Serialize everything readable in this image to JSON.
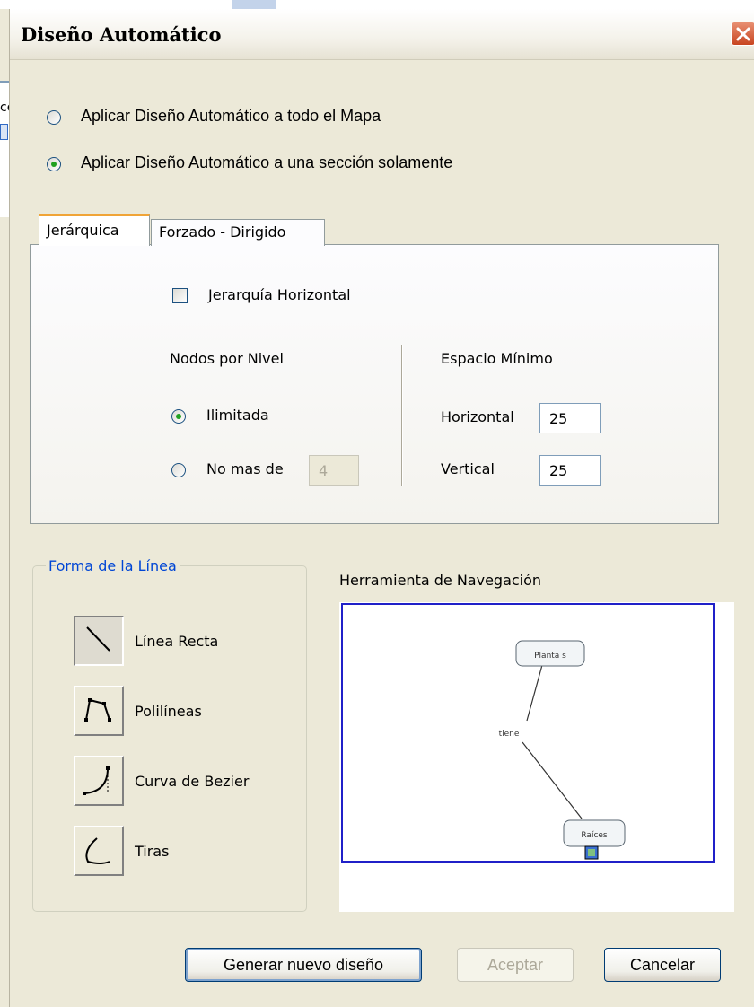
{
  "window": {
    "title": "Diseño Automático"
  },
  "background": {
    "partial_text": "ce"
  },
  "scope": {
    "options": [
      {
        "label": "Aplicar Diseño Automático a todo el Mapa",
        "selected": false
      },
      {
        "label": "Aplicar Diseño Automático a una sección solamente",
        "selected": true
      }
    ]
  },
  "tabs": [
    {
      "label": "Jerárquica",
      "active": true
    },
    {
      "label": "Forzado  - Dirigido",
      "active": false
    }
  ],
  "hierarchy": {
    "horizontal_label": "Jerarquía Horizontal",
    "horizontal_checked": false,
    "nodes_per_level": {
      "title": "Nodos por Nivel",
      "unlimited_label": "Ilimitada",
      "max_label": "No mas de",
      "max_value": "4",
      "selected": "unlimited"
    },
    "min_space": {
      "title": "Espacio Mínimo",
      "horizontal_label": "Horizontal",
      "horizontal_value": "25",
      "vertical_label": "Vertical",
      "vertical_value": "25"
    }
  },
  "line_shape": {
    "title": "Forma de la Línea",
    "options": [
      {
        "label": "Línea Recta",
        "icon": "straight-line-icon",
        "selected": true
      },
      {
        "label": "Polilíneas",
        "icon": "polyline-icon",
        "selected": false
      },
      {
        "label": "Curva de Bezier",
        "icon": "bezier-curve-icon",
        "selected": false
      },
      {
        "label": "Tiras",
        "icon": "strip-icon",
        "selected": false
      }
    ]
  },
  "navigator": {
    "title": "Herramienta de Navegación",
    "nodes": [
      {
        "label": "Planta s"
      },
      {
        "label": "Raíces"
      }
    ],
    "link_label": "tiene"
  },
  "buttons": {
    "generate": "Generar nuevo diseño",
    "accept": "Aceptar",
    "cancel": "Cancelar"
  },
  "colors": {
    "radio_dot": "#21a121",
    "tab_highlight": "#f0a437",
    "group_title": "#0046d5",
    "navigator_frame": "#2020c8",
    "close_button": "#c84420"
  }
}
